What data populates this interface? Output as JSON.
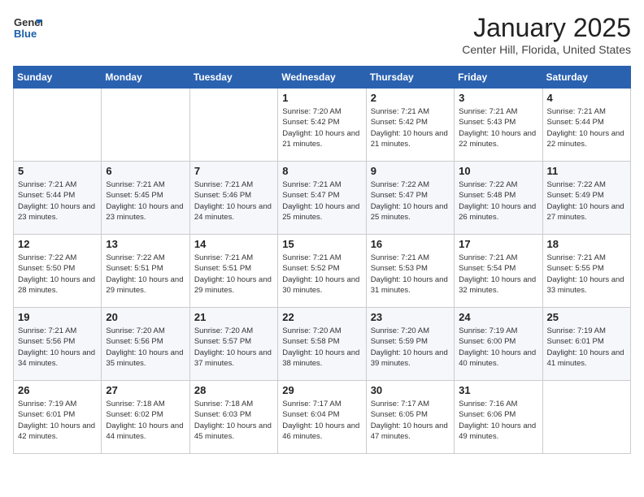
{
  "header": {
    "logo_general": "General",
    "logo_blue": "Blue",
    "title": "January 2025",
    "subtitle": "Center Hill, Florida, United States"
  },
  "days_of_week": [
    "Sunday",
    "Monday",
    "Tuesday",
    "Wednesday",
    "Thursday",
    "Friday",
    "Saturday"
  ],
  "weeks": [
    [
      {
        "day": "",
        "sunrise": "",
        "sunset": "",
        "daylight": ""
      },
      {
        "day": "",
        "sunrise": "",
        "sunset": "",
        "daylight": ""
      },
      {
        "day": "",
        "sunrise": "",
        "sunset": "",
        "daylight": ""
      },
      {
        "day": "1",
        "sunrise": "7:20 AM",
        "sunset": "5:42 PM",
        "daylight": "10 hours and 21 minutes."
      },
      {
        "day": "2",
        "sunrise": "7:21 AM",
        "sunset": "5:42 PM",
        "daylight": "10 hours and 21 minutes."
      },
      {
        "day": "3",
        "sunrise": "7:21 AM",
        "sunset": "5:43 PM",
        "daylight": "10 hours and 22 minutes."
      },
      {
        "day": "4",
        "sunrise": "7:21 AM",
        "sunset": "5:44 PM",
        "daylight": "10 hours and 22 minutes."
      }
    ],
    [
      {
        "day": "5",
        "sunrise": "7:21 AM",
        "sunset": "5:44 PM",
        "daylight": "10 hours and 23 minutes."
      },
      {
        "day": "6",
        "sunrise": "7:21 AM",
        "sunset": "5:45 PM",
        "daylight": "10 hours and 23 minutes."
      },
      {
        "day": "7",
        "sunrise": "7:21 AM",
        "sunset": "5:46 PM",
        "daylight": "10 hours and 24 minutes."
      },
      {
        "day": "8",
        "sunrise": "7:21 AM",
        "sunset": "5:47 PM",
        "daylight": "10 hours and 25 minutes."
      },
      {
        "day": "9",
        "sunrise": "7:22 AM",
        "sunset": "5:47 PM",
        "daylight": "10 hours and 25 minutes."
      },
      {
        "day": "10",
        "sunrise": "7:22 AM",
        "sunset": "5:48 PM",
        "daylight": "10 hours and 26 minutes."
      },
      {
        "day": "11",
        "sunrise": "7:22 AM",
        "sunset": "5:49 PM",
        "daylight": "10 hours and 27 minutes."
      }
    ],
    [
      {
        "day": "12",
        "sunrise": "7:22 AM",
        "sunset": "5:50 PM",
        "daylight": "10 hours and 28 minutes."
      },
      {
        "day": "13",
        "sunrise": "7:22 AM",
        "sunset": "5:51 PM",
        "daylight": "10 hours and 29 minutes."
      },
      {
        "day": "14",
        "sunrise": "7:21 AM",
        "sunset": "5:51 PM",
        "daylight": "10 hours and 29 minutes."
      },
      {
        "day": "15",
        "sunrise": "7:21 AM",
        "sunset": "5:52 PM",
        "daylight": "10 hours and 30 minutes."
      },
      {
        "day": "16",
        "sunrise": "7:21 AM",
        "sunset": "5:53 PM",
        "daylight": "10 hours and 31 minutes."
      },
      {
        "day": "17",
        "sunrise": "7:21 AM",
        "sunset": "5:54 PM",
        "daylight": "10 hours and 32 minutes."
      },
      {
        "day": "18",
        "sunrise": "7:21 AM",
        "sunset": "5:55 PM",
        "daylight": "10 hours and 33 minutes."
      }
    ],
    [
      {
        "day": "19",
        "sunrise": "7:21 AM",
        "sunset": "5:56 PM",
        "daylight": "10 hours and 34 minutes."
      },
      {
        "day": "20",
        "sunrise": "7:20 AM",
        "sunset": "5:56 PM",
        "daylight": "10 hours and 35 minutes."
      },
      {
        "day": "21",
        "sunrise": "7:20 AM",
        "sunset": "5:57 PM",
        "daylight": "10 hours and 37 minutes."
      },
      {
        "day": "22",
        "sunrise": "7:20 AM",
        "sunset": "5:58 PM",
        "daylight": "10 hours and 38 minutes."
      },
      {
        "day": "23",
        "sunrise": "7:20 AM",
        "sunset": "5:59 PM",
        "daylight": "10 hours and 39 minutes."
      },
      {
        "day": "24",
        "sunrise": "7:19 AM",
        "sunset": "6:00 PM",
        "daylight": "10 hours and 40 minutes."
      },
      {
        "day": "25",
        "sunrise": "7:19 AM",
        "sunset": "6:01 PM",
        "daylight": "10 hours and 41 minutes."
      }
    ],
    [
      {
        "day": "26",
        "sunrise": "7:19 AM",
        "sunset": "6:01 PM",
        "daylight": "10 hours and 42 minutes."
      },
      {
        "day": "27",
        "sunrise": "7:18 AM",
        "sunset": "6:02 PM",
        "daylight": "10 hours and 44 minutes."
      },
      {
        "day": "28",
        "sunrise": "7:18 AM",
        "sunset": "6:03 PM",
        "daylight": "10 hours and 45 minutes."
      },
      {
        "day": "29",
        "sunrise": "7:17 AM",
        "sunset": "6:04 PM",
        "daylight": "10 hours and 46 minutes."
      },
      {
        "day": "30",
        "sunrise": "7:17 AM",
        "sunset": "6:05 PM",
        "daylight": "10 hours and 47 minutes."
      },
      {
        "day": "31",
        "sunrise": "7:16 AM",
        "sunset": "6:06 PM",
        "daylight": "10 hours and 49 minutes."
      },
      {
        "day": "",
        "sunrise": "",
        "sunset": "",
        "daylight": ""
      }
    ]
  ]
}
